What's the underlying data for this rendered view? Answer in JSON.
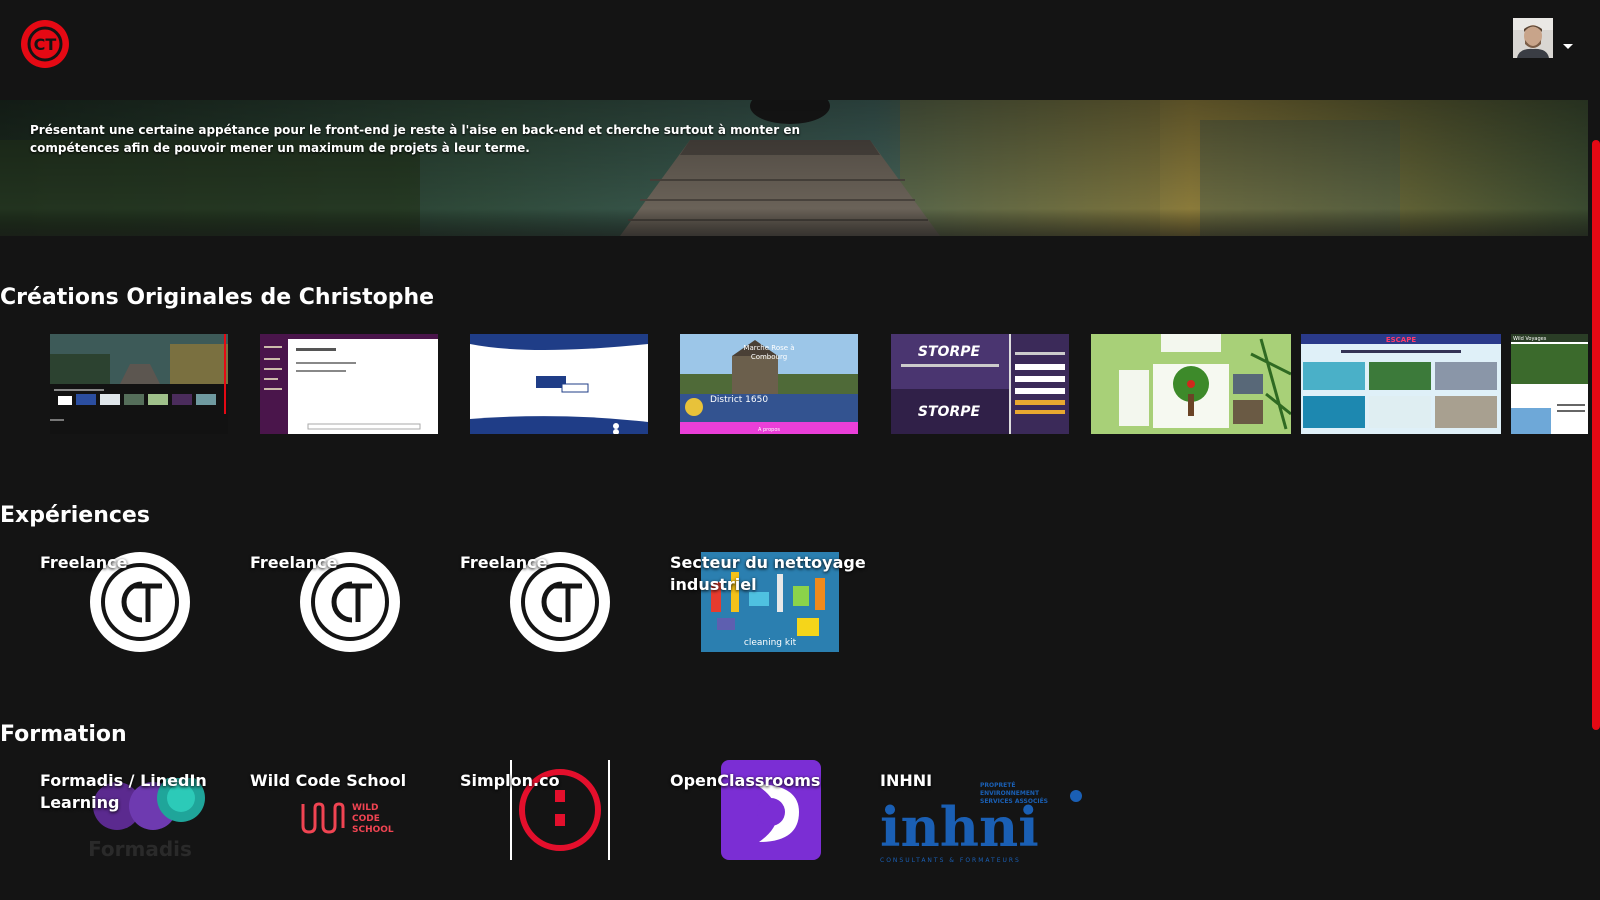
{
  "header": {
    "logo_text": "CT",
    "avatar_alt": "profile"
  },
  "hero": {
    "text": "Présentant une certaine appétance pour le front-end je reste à l'aise en back-end et cherche surtout à monter en compétences afin de pouvoir mener un maximum de projets à leur terme."
  },
  "creations": {
    "title": "Créations Originales de Christophe",
    "thumbnails": [
      {
        "name": "portfolio"
      },
      {
        "name": "chat-app"
      },
      {
        "name": "dashboard"
      },
      {
        "name": "marche-rose",
        "caption_1": "Marche Rose à",
        "caption_2": "Combourg",
        "footer": "A propos",
        "badge": "District 1650"
      },
      {
        "name": "storpe",
        "brand_1": "STORPE",
        "brand_2": "STORPE"
      },
      {
        "name": "tree-app"
      },
      {
        "name": "escape",
        "brand": "ESCAPE"
      },
      {
        "name": "wild-voyages",
        "brand": "Wild Voyages"
      }
    ]
  },
  "experiences": {
    "title": "Expériences",
    "items": [
      {
        "label": "Freelance"
      },
      {
        "label": "Freelance"
      },
      {
        "label": "Freelance"
      },
      {
        "label": "Secteur du nettoyage industriel",
        "image_caption": "cleaning kit"
      }
    ]
  },
  "formation": {
    "title": "Formation",
    "items": [
      {
        "label": "Formadis / LinedIn Learning",
        "logo_text": "Formadis"
      },
      {
        "label": "Wild Code School",
        "logo_line1": "WILD",
        "logo_line2": "CODE",
        "logo_line3": "SCHOOL"
      },
      {
        "label": "Simplon.co"
      },
      {
        "label": "OpenClassrooms"
      },
      {
        "label": "INHNI",
        "logo_big": "inhni",
        "logo_sub1": "PROPRETÉ",
        "logo_sub2": "ENVIRONNEMENT",
        "logo_sub3": "SERVICES ASSOCIÉS",
        "logo_tag": "CONSULTANTS & FORMATEURS"
      }
    ]
  },
  "colors": {
    "accent": "#e50914",
    "background": "#141414"
  }
}
